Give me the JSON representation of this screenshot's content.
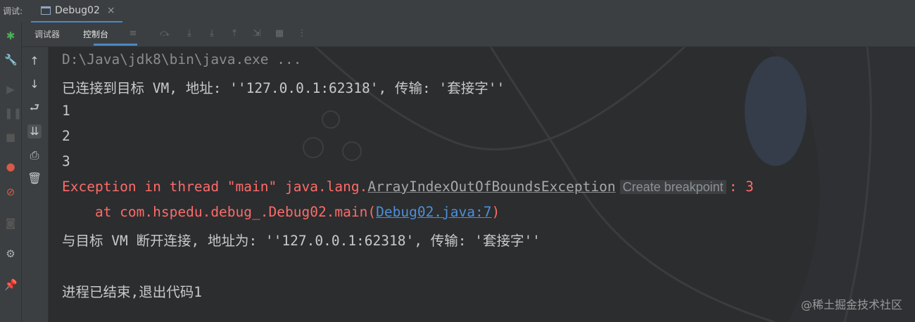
{
  "topbar": {
    "debug_label": "调试:",
    "run_tab_title": "Debug02"
  },
  "subtoolbar": {
    "tab_debugger": "调试器",
    "tab_console": "控制台"
  },
  "console": {
    "command": "D:\\Java\\jdk8\\bin\\java.exe ...",
    "connected": "已连接到目标 VM, 地址: ''127.0.0.1:62318', 传输: '套接字''",
    "out1": "1",
    "out2": "2",
    "out3": "3",
    "exception_prefix": "Exception in thread \"main\" java.lang.",
    "exception_class": "ArrayIndexOutOfBoundsException",
    "breakpoint_hint": "Create breakpoint",
    "exception_suffix": ": 3",
    "stack_prefix": "    at com.hspedu.debug_.Debug02.main(",
    "stack_link": "Debug02.java:7",
    "stack_suffix": ")",
    "disconnected": "与目标 VM 断开连接, 地址为: ''127.0.0.1:62318', 传输: '套接字''",
    "finished": "进程已结束,退出代码1"
  },
  "watermark": "@稀土掘金技术社区",
  "colors": {
    "accent": "#4a88c7",
    "error": "#ff6b68",
    "link": "#4e8fd6",
    "background": "#2b2d2f"
  }
}
